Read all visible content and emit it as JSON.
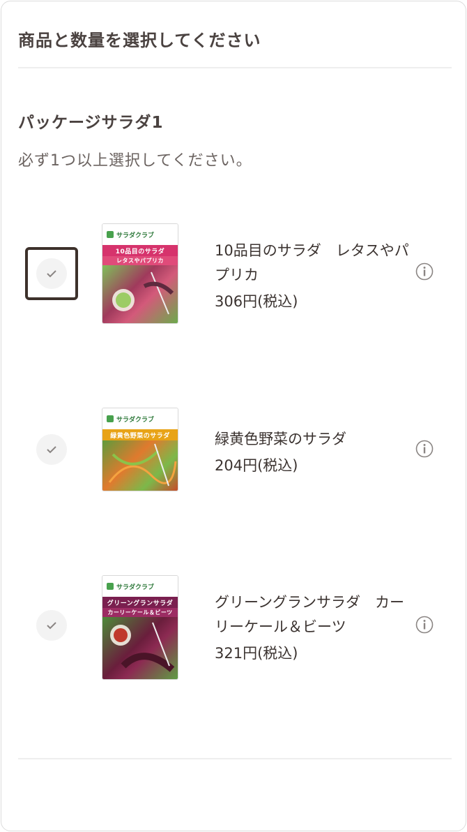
{
  "header": {
    "title": "商品と数量を選択してください"
  },
  "section": {
    "title": "パッケージサラダ1",
    "note": "必ず1つ以上選択してください。"
  },
  "items": [
    {
      "name": "10品目のサラダ　レタスやパプリカ",
      "price": "306円(税込)",
      "selected": false,
      "focused": true,
      "package_brand": "サラダクラブ",
      "package_title": "10品目のサラダ",
      "package_subtitle": "レタスやパプリカ"
    },
    {
      "name": "緑黄色野菜のサラダ",
      "price": "204円(税込)",
      "selected": false,
      "focused": false,
      "package_brand": "サラダクラブ",
      "package_title": "緑黄色野菜のサラダ",
      "package_subtitle": ""
    },
    {
      "name": "グリーングランサラダ　カーリーケール＆ビーツ",
      "price": "321円(税込)",
      "selected": false,
      "focused": false,
      "package_brand": "サラダクラブ",
      "package_title": "グリーングランサラダ",
      "package_subtitle": "カーリーケール＆ビーツ"
    }
  ],
  "colors": {
    "focus_border": "#3d312b",
    "check_bg": "#f3f3f3",
    "check_mark": "#8a8583",
    "text": "#3b3330",
    "brand_green": "#48a14d",
    "pkg1_band": "#d6336c",
    "pkg2_band": "#e8a317",
    "pkg3_band": "#7a1f4f"
  },
  "icons": {
    "check": "check-icon",
    "info": "info-icon"
  }
}
